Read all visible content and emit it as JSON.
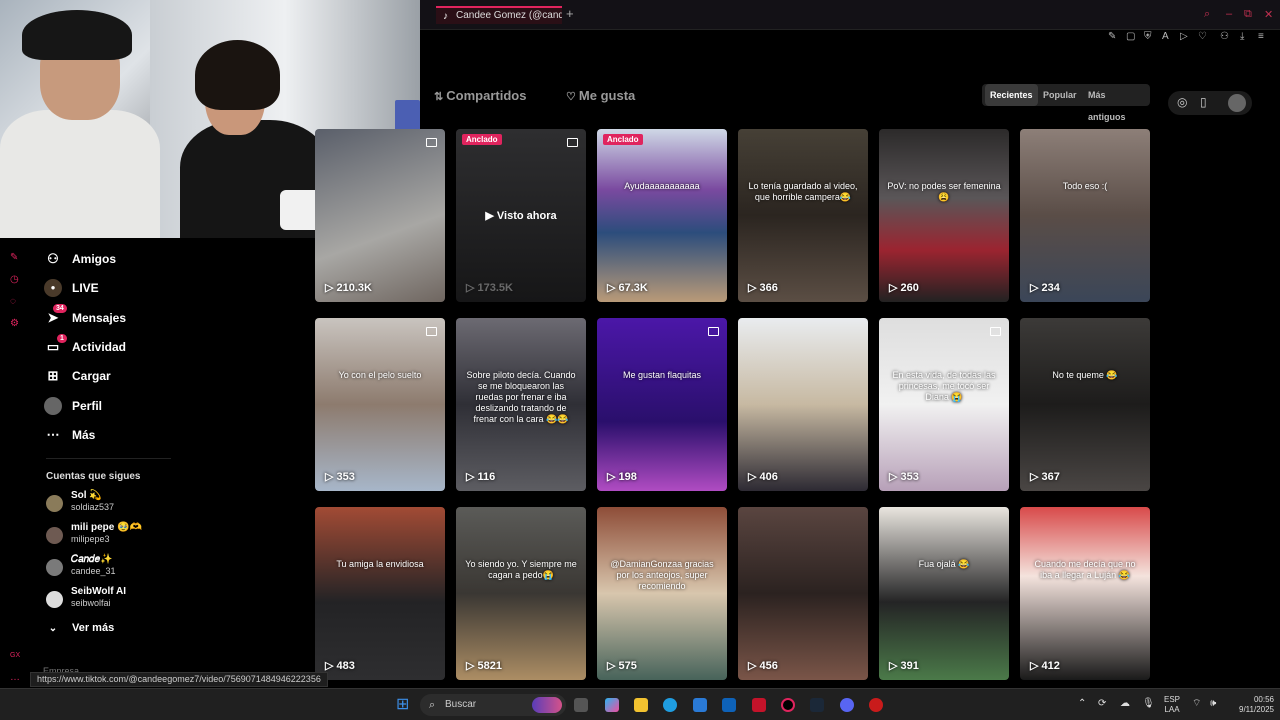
{
  "browser": {
    "tab_title": "Candee Gomez (@candee",
    "new_tab": "+",
    "controls": [
      "⌕",
      "–",
      "⧉",
      "✕"
    ]
  },
  "profile_tabs": {
    "reposts": "Compartidos",
    "likes": "Me gusta"
  },
  "sort": {
    "recent": "Recientes",
    "popular": "Popular",
    "oldest": "Más antiguos"
  },
  "sidebar": {
    "items": [
      {
        "label": "Amigos",
        "icon": "friends-icon"
      },
      {
        "label": "LIVE",
        "icon": "live-icon"
      },
      {
        "label": "Mensajes",
        "icon": "messages-icon",
        "badge": "34"
      },
      {
        "label": "Actividad",
        "icon": "activity-icon",
        "badge": "1"
      },
      {
        "label": "Cargar",
        "icon": "upload-icon"
      },
      {
        "label": "Perfil",
        "icon": "profile-icon"
      },
      {
        "label": "Más",
        "icon": "more-icon"
      }
    ],
    "following_title": "Cuentas que sigues",
    "following": [
      {
        "name": "Sol 💫",
        "handle": "soldiaz537"
      },
      {
        "name": "mili pepe 🥹🫶",
        "handle": "milipepe3"
      },
      {
        "name": "𝐶𝑎𝑛𝑑𝑒✨",
        "handle": "candee_31"
      },
      {
        "name": "SeibWolf AI",
        "handle": "seibwolfai"
      }
    ],
    "see_more": "Ver más",
    "company": "Empresa"
  },
  "videos": [
    {
      "views": "210.3K",
      "caption": ""
    },
    {
      "views": "173.5K",
      "caption": "",
      "pinned": "Anclado",
      "watched": "Visto ahora"
    },
    {
      "views": "67.3K",
      "caption": "Ayudaaaaaaaaaaa",
      "pinned": "Anclado"
    },
    {
      "views": "366",
      "caption": "Lo tenía guardado al video, que horrible campera😂"
    },
    {
      "views": "260",
      "caption": "PoV: no podes ser femenina 😩"
    },
    {
      "views": "234",
      "caption": "Todo eso :("
    },
    {
      "views": "353",
      "caption": "Yo con el pelo suelto"
    },
    {
      "views": "116",
      "caption": "Sobre piloto decía. Cuando se me bloquearon las ruedas por frenar e iba deslizando tratando de frenar con la cara 😂😂"
    },
    {
      "views": "198",
      "caption": "Me gustan flaquitas"
    },
    {
      "views": "406",
      "caption": ""
    },
    {
      "views": "353",
      "caption": "En esta vida, de todas las princesas, me tocó ser Diana 😭"
    },
    {
      "views": "367",
      "caption": "No te queme 😂"
    },
    {
      "views": "483",
      "caption": "Tu amiga la envidiosa"
    },
    {
      "views": "5821",
      "caption": "Yo siendo yo. Y siempre me cagan a pedo😭"
    },
    {
      "views": "575",
      "caption": "@DamianGonzaa gracias por los anteojos, super recomiendo"
    },
    {
      "views": "456",
      "caption": ""
    },
    {
      "views": "391",
      "caption": "Fua ojalá 😂"
    },
    {
      "views": "412",
      "caption": "Cuando me decía que no iba a llegar a Luján 😂"
    }
  ],
  "status_url": "https://www.tiktok.com/@candeegomez7/video/7569071484946222356",
  "taskbar": {
    "search_placeholder": "Buscar",
    "lang_line1": "ESP",
    "lang_line2": "LAA",
    "time": "00:56",
    "date": "9/11/2025"
  },
  "colors": {
    "accent": "#e0245e",
    "background": "#000000"
  }
}
